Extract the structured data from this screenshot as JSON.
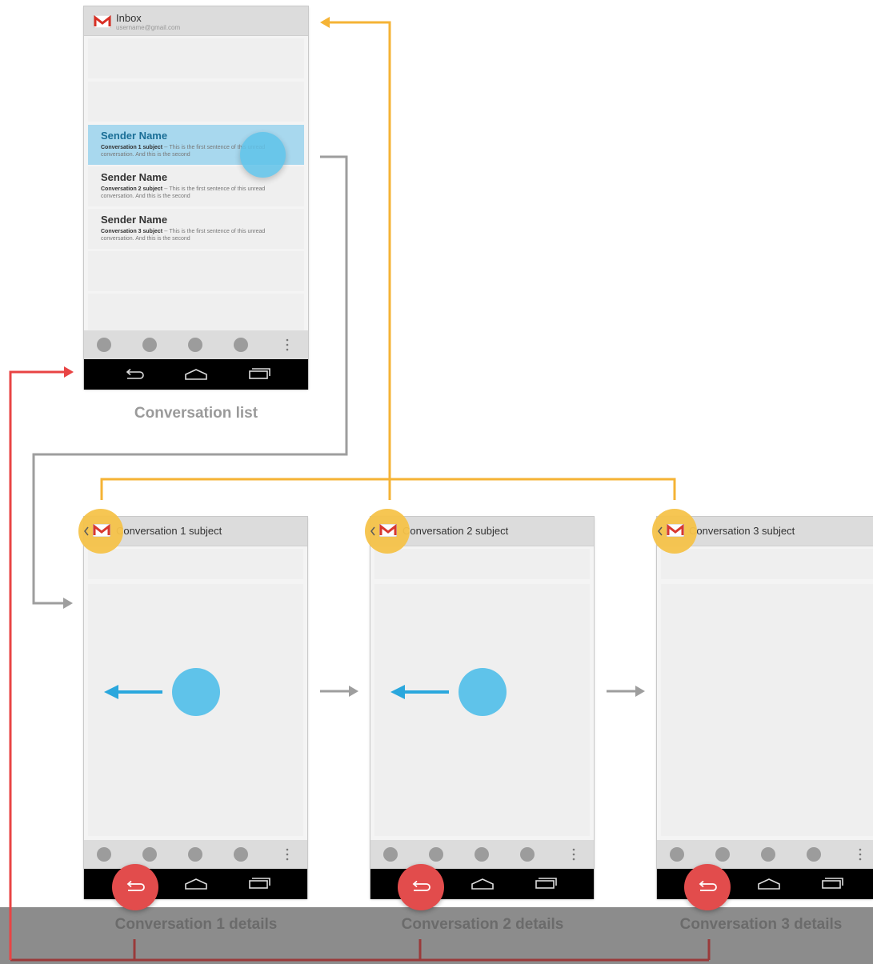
{
  "inbox": {
    "title": "Inbox",
    "account": "username@gmail.com",
    "rows": [
      {
        "sender": "Sender Name",
        "subject": "Conversation 1 subject",
        "snippet": " -- This is the first sentence of this unread conversation. And this is the second",
        "selected": true
      },
      {
        "sender": "Sender Name",
        "subject": "Conversation 2 subject",
        "snippet": " -- This is the first sentence of this unread conversation. And this is the second",
        "selected": false
      },
      {
        "sender": "Sender Name",
        "subject": "Conversation 3 subject",
        "snippet": " -- This is the first sentence of this unread conversation. And this is the second",
        "selected": false
      }
    ],
    "caption": "Conversation list"
  },
  "details": [
    {
      "title": "Conversation 1 subject",
      "caption": "Conversation 1 details"
    },
    {
      "title": "Conversation 2 subject",
      "caption": "Conversation 2 details"
    },
    {
      "title": "Conversation 3 subject",
      "caption": "Conversation 3 details"
    }
  ],
  "colors": {
    "up_arrow": "#f5b335",
    "back_arrow": "#e84444",
    "back_arrow_dark": "#9a3a3a",
    "flow_arrow": "#9e9e9e",
    "tap": "#5fc3ea",
    "swipe": "#2aa7dd"
  },
  "icons": [
    "gmail-icon",
    "back-icon",
    "home-icon",
    "recents-icon",
    "overflow-icon",
    "chevron-left-icon"
  ]
}
